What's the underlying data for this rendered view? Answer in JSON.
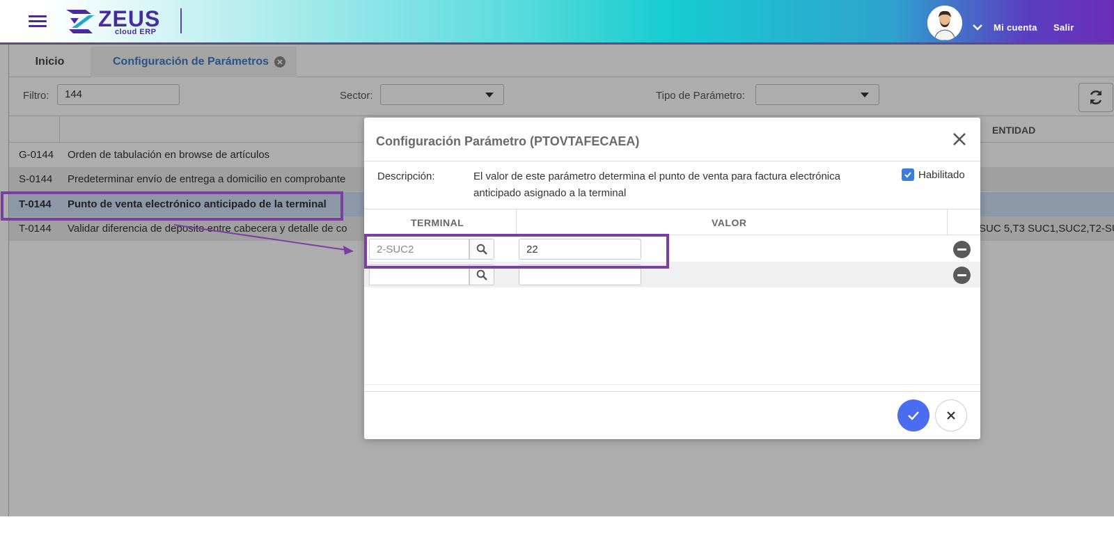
{
  "header": {
    "logo_name": "ZEUS",
    "logo_sub": "cloud ERP",
    "account_label": "Mi cuenta",
    "logout_label": "Salir"
  },
  "tabs": [
    {
      "label": "Inicio"
    },
    {
      "label": "Configuración de Parámetros"
    }
  ],
  "filters": {
    "filter_label": "Filtro:",
    "filter_value": "144",
    "sector_label": "Sector:",
    "sector_value": "",
    "type_label": "Tipo de Parámetro:",
    "type_value": ""
  },
  "grid": {
    "entity_header": "ENTIDAD",
    "rows": [
      {
        "code": "G-0144",
        "description": "Orden de tabulación en browse de artículos",
        "entity": ""
      },
      {
        "code": "S-0144",
        "description": "Predeterminar envío de entrega a domicilio en comprobante",
        "entity": ""
      },
      {
        "code": "T-0144",
        "description": "Punto de venta electrónico anticipado de la terminal",
        "entity": ""
      },
      {
        "code": "T-0144",
        "description": "Validar diferencia de deposito entre cabecera y detalle de co",
        "entity": "SUC 5,T3 SUC1,SUC2,T2-SU"
      }
    ]
  },
  "dialog": {
    "title": "Configuración Parámetro (PTOVTAFECAEA)",
    "description_label": "Descripción:",
    "description_text": "El valor de este parámetro determina el punto de venta para factura electrónica anticipado asignado a la terminal",
    "enabled_label": "Habilitado",
    "enabled": true,
    "columns": {
      "terminal": "TERMINAL",
      "value": "VALOR"
    },
    "rows": [
      {
        "terminal": "2-SUC2",
        "value": "22"
      },
      {
        "terminal": "",
        "value": ""
      }
    ]
  },
  "colors": {
    "brand": "#4a2b9e",
    "highlight": "#7c3ea4",
    "accept": "#4a6cf0"
  }
}
